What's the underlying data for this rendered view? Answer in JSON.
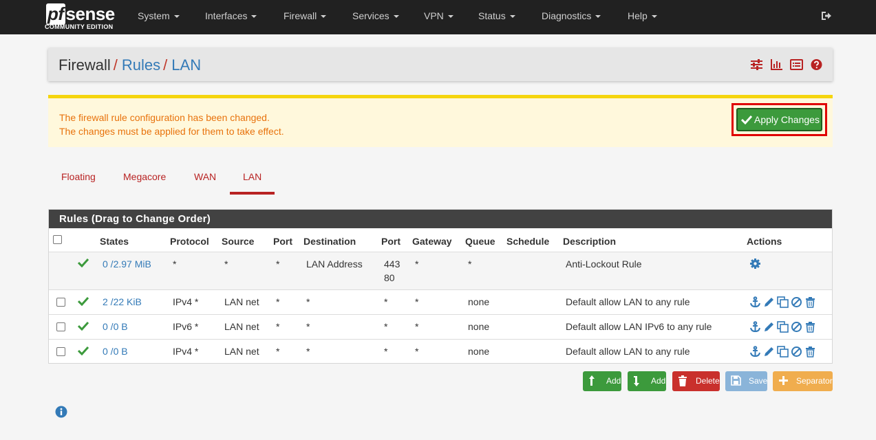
{
  "brand": {
    "name": "sense",
    "pf": "pf",
    "sub": "COMMUNITY EDITION"
  },
  "nav": {
    "items": [
      {
        "label": "System"
      },
      {
        "label": "Interfaces"
      },
      {
        "label": "Firewall"
      },
      {
        "label": "Services"
      },
      {
        "label": "VPN"
      },
      {
        "label": "Status"
      },
      {
        "label": "Diagnostics"
      },
      {
        "label": "Help"
      }
    ],
    "logout_icon": "sign-out-icon"
  },
  "breadcrumb": {
    "root": "Firewall",
    "sep": "/",
    "level1": "Rules",
    "level2": "LAN"
  },
  "header_icons": [
    "sliders-icon",
    "bar-chart-icon",
    "list-alt-icon",
    "question-circle-icon"
  ],
  "alert": {
    "line1": "The firewall rule configuration has been changed.",
    "line2": "The changes must be applied for them to take effect.",
    "apply_label": "Apply Changes"
  },
  "tabs": [
    {
      "label": "Floating"
    },
    {
      "label": "Megacore"
    },
    {
      "label": "WAN"
    },
    {
      "label": "LAN",
      "active": true
    }
  ],
  "table": {
    "title": "Rules (Drag to Change Order)",
    "headers": [
      "States",
      "Protocol",
      "Source",
      "Port",
      "Destination",
      "Port",
      "Gateway",
      "Queue",
      "Schedule",
      "Description",
      "Actions"
    ],
    "rows": [
      {
        "states": "0 /2.97 MiB",
        "protocol": "*",
        "source": "*",
        "port": "*",
        "destination": "LAN Address",
        "dport1": "443",
        "dport2": "80",
        "gateway": "*",
        "queue": "*",
        "schedule": "",
        "description": "Anti-Lockout Rule"
      },
      {
        "states": "2 /22 KiB",
        "protocol": "IPv4 *",
        "source": "LAN net",
        "port": "*",
        "destination": "*",
        "dport1": "*",
        "dport2": "",
        "gateway": "*",
        "queue": "none",
        "schedule": "",
        "description": "Default allow LAN to any rule"
      },
      {
        "states": "0 /0 B",
        "protocol": "IPv6 *",
        "source": "LAN net",
        "port": "*",
        "destination": "*",
        "dport1": "*",
        "dport2": "",
        "gateway": "*",
        "queue": "none",
        "schedule": "",
        "description": "Default allow LAN IPv6 to any rule"
      },
      {
        "states": "0 /0 B",
        "protocol": "IPv4 *",
        "source": "LAN net",
        "port": "*",
        "destination": "*",
        "dport1": "*",
        "dport2": "",
        "gateway": "*",
        "queue": "none",
        "schedule": "",
        "description": "Default allow LAN to any rule"
      }
    ]
  },
  "buttons": {
    "add_top": "Add",
    "add_bottom": "Add",
    "delete": "Delete",
    "save": "Save",
    "separator": "Separator"
  },
  "colors": {
    "navbar": "#212121",
    "accent_red": "#b82222",
    "link_blue": "#337ab7",
    "success_green": "#3c9a3c",
    "danger_red": "#c9302c",
    "save_blue": "#8ab4d9",
    "warning_orange": "#f0ad4e",
    "alert_bg": "#fff8dc",
    "alert_text": "#e8720c"
  }
}
